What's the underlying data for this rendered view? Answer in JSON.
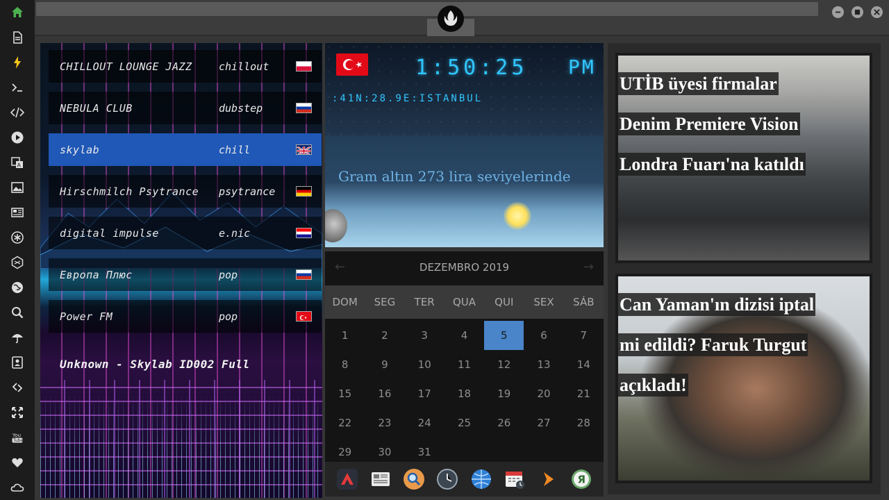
{
  "window": {
    "emblem_icon": "rebel-alliance-icon",
    "buttons": [
      "minimize-icon",
      "maximize-icon",
      "close-icon"
    ]
  },
  "sidebar": {
    "items": [
      {
        "icon": "home-icon",
        "color": "#4caf50"
      },
      {
        "icon": "document-icon"
      },
      {
        "icon": "lightning-icon",
        "color": "#f5c518"
      },
      {
        "icon": "terminal-icon"
      },
      {
        "icon": "code-icon"
      },
      {
        "icon": "play-icon"
      },
      {
        "icon": "translate-icon"
      },
      {
        "icon": "image-icon"
      },
      {
        "icon": "news-icon"
      },
      {
        "icon": "asterisk-icon"
      },
      {
        "icon": "hexagon-icon"
      },
      {
        "icon": "globe-icon"
      },
      {
        "icon": "search-icon"
      },
      {
        "icon": "umbrella-icon"
      },
      {
        "icon": "contact-card-icon"
      },
      {
        "icon": "link-icon"
      },
      {
        "icon": "expand-icon"
      },
      {
        "icon": "youtube-icon"
      },
      {
        "icon": "heart-icon"
      },
      {
        "icon": "cloud-icon"
      }
    ]
  },
  "radio": {
    "stations": [
      {
        "name": "CHILLOUT LOUNGE JAZZ",
        "genre": "chillout",
        "flag": "poland"
      },
      {
        "name": "NEBULA CLUB",
        "genre": "dubstep",
        "flag": "russia"
      },
      {
        "name": "skylab",
        "genre": "chill",
        "flag": "uk",
        "active": true
      },
      {
        "name": "Hirschmilch Psytrance",
        "genre": "psytrance",
        "flag": "germany"
      },
      {
        "name": "digital impulse",
        "genre": "e.nic",
        "flag": "croatia"
      },
      {
        "name": "Европа Плюс",
        "genre": "pop",
        "flag": "russia"
      },
      {
        "name": "Power FM",
        "genre": "pop",
        "flag": "turkey"
      }
    ],
    "now_playing": "Unknown - Skylab ID002 Full"
  },
  "clock": {
    "flag": "turkey",
    "time": "1:50:25",
    "ampm": "PM",
    "coords": ":41N:28.9E:ISTANBUL",
    "ticker": "Gram altın 273 lira seviyelerinde"
  },
  "calendar": {
    "month": "DEZEMBRO 2019",
    "weekdays": [
      "DOM",
      "SEG",
      "TER",
      "QUA",
      "QUI",
      "SEX",
      "SÁB"
    ],
    "weeks": [
      [
        "1",
        "2",
        "3",
        "4",
        "5",
        "6",
        "7"
      ],
      [
        "8",
        "9",
        "10",
        "11",
        "12",
        "13",
        "14"
      ],
      [
        "15",
        "16",
        "17",
        "18",
        "19",
        "20",
        "21"
      ],
      [
        "22",
        "23",
        "24",
        "25",
        "26",
        "27",
        "28"
      ],
      [
        "29",
        "30",
        "31",
        "",
        "",
        "",
        ""
      ]
    ],
    "today": "5",
    "accent": "#4a84c9"
  },
  "dock": {
    "apps": [
      {
        "icon": "red-triangle-app-icon"
      },
      {
        "icon": "newspaper-app-icon"
      },
      {
        "icon": "magnifier-app-icon"
      },
      {
        "icon": "clock-app-icon"
      },
      {
        "icon": "globe-app-icon"
      },
      {
        "icon": "calendar-app-icon"
      },
      {
        "icon": "arrow-app-icon"
      },
      {
        "icon": "yandex-app-icon"
      }
    ]
  },
  "news": {
    "items": [
      {
        "title": "UTİB üyesi firmalar Denim Premiere Vision Londra Fuarı'na katıldı"
      },
      {
        "title": "Can Yaman'ın dizisi iptal mi edildi? Faruk Turgut açıkladı!"
      }
    ]
  }
}
